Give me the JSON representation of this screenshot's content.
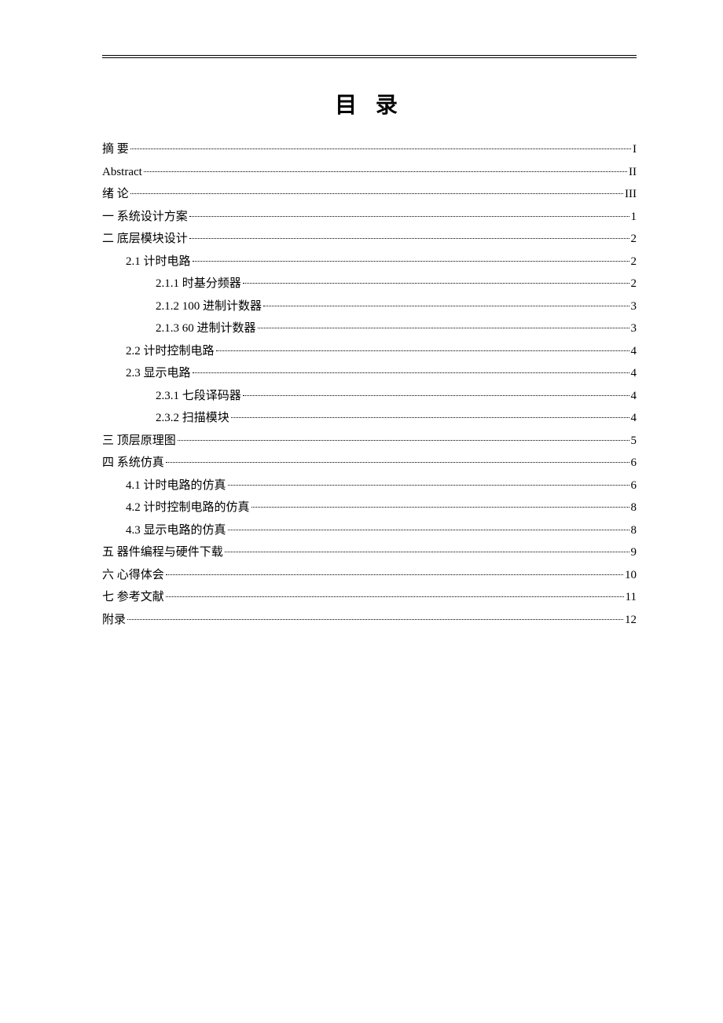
{
  "title": "目 录",
  "entries": [
    {
      "label": "摘  要",
      "page": "I",
      "indent": 0
    },
    {
      "label": "Abstract",
      "page": "II",
      "indent": 0
    },
    {
      "label": "绪  论",
      "page": "III",
      "indent": 0
    },
    {
      "label": "一  系统设计方案",
      "page": "1",
      "indent": 0
    },
    {
      "label": "二  底层模块设计",
      "page": "2",
      "indent": 0
    },
    {
      "label": "2.1  计时电路",
      "page": "2",
      "indent": 1
    },
    {
      "label": "2.1.1 时基分频器",
      "page": "2",
      "indent": 2
    },
    {
      "label": "2.1.2 100 进制计数器",
      "page": "3",
      "indent": 2
    },
    {
      "label": "2.1.3 60 进制计数器",
      "page": "3",
      "indent": 2
    },
    {
      "label": "2.2  计时控制电路",
      "page": "4",
      "indent": 1
    },
    {
      "label": "2.3  显示电路",
      "page": "4",
      "indent": 1
    },
    {
      "label": "2.3.1  七段译码器",
      "page": "4",
      "indent": 2
    },
    {
      "label": "2.3.2  扫描模块",
      "page": "4",
      "indent": 2
    },
    {
      "label": "三  顶层原理图",
      "page": "5",
      "indent": 0
    },
    {
      "label": "四  系统仿真",
      "page": "6",
      "indent": 0
    },
    {
      "label": "4.1 计时电路的仿真",
      "page": "6",
      "indent": 1
    },
    {
      "label": "4.2 计时控制电路的仿真",
      "page": "8",
      "indent": 1
    },
    {
      "label": "4.3 显示电路的仿真",
      "page": "8",
      "indent": 1
    },
    {
      "label": "五  器件编程与硬件下载",
      "page": "9",
      "indent": 0
    },
    {
      "label": "六  心得体会",
      "page": "10",
      "indent": 0
    },
    {
      "label": "七  参考文献",
      "page": "11",
      "indent": 0
    },
    {
      "label": "附录",
      "page": "12",
      "indent": 0
    }
  ]
}
